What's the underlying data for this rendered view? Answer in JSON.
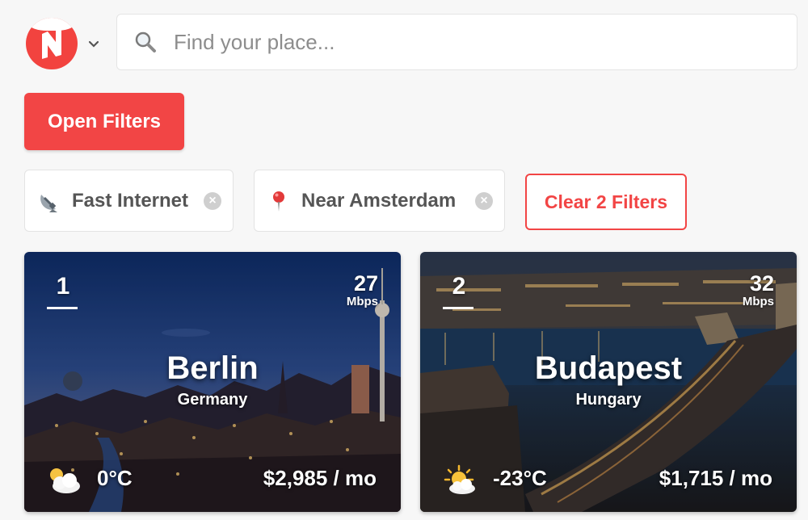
{
  "header": {
    "logo_icon": "nomadlist-logo-icon",
    "menu_icon": "chevron-down-icon",
    "search": {
      "placeholder": "Find your place...",
      "value": "",
      "icon": "search-icon"
    }
  },
  "filters": {
    "open_label": "Open Filters",
    "chips": [
      {
        "icon": "satellite-dish-icon",
        "label": "Fast Internet"
      },
      {
        "icon": "map-pin-icon",
        "label": "Near Amsterdam"
      }
    ],
    "clear_label": "Clear 2 Filters"
  },
  "cities": [
    {
      "rank": "1",
      "speed": "27",
      "speed_unit": "Mbps",
      "name": "Berlin",
      "country": "Germany",
      "weather_icon": "cloudy-icon",
      "temperature": "0°C",
      "cost": "$2,985 / mo"
    },
    {
      "rank": "2",
      "speed": "32",
      "speed_unit": "Mbps",
      "name": "Budapest",
      "country": "Hungary",
      "weather_icon": "partly-sunny-icon",
      "temperature": "-23°C",
      "cost": "$1,715 / mo"
    }
  ],
  "colors": {
    "accent": "#f24545",
    "background": "#f7f7f7"
  }
}
